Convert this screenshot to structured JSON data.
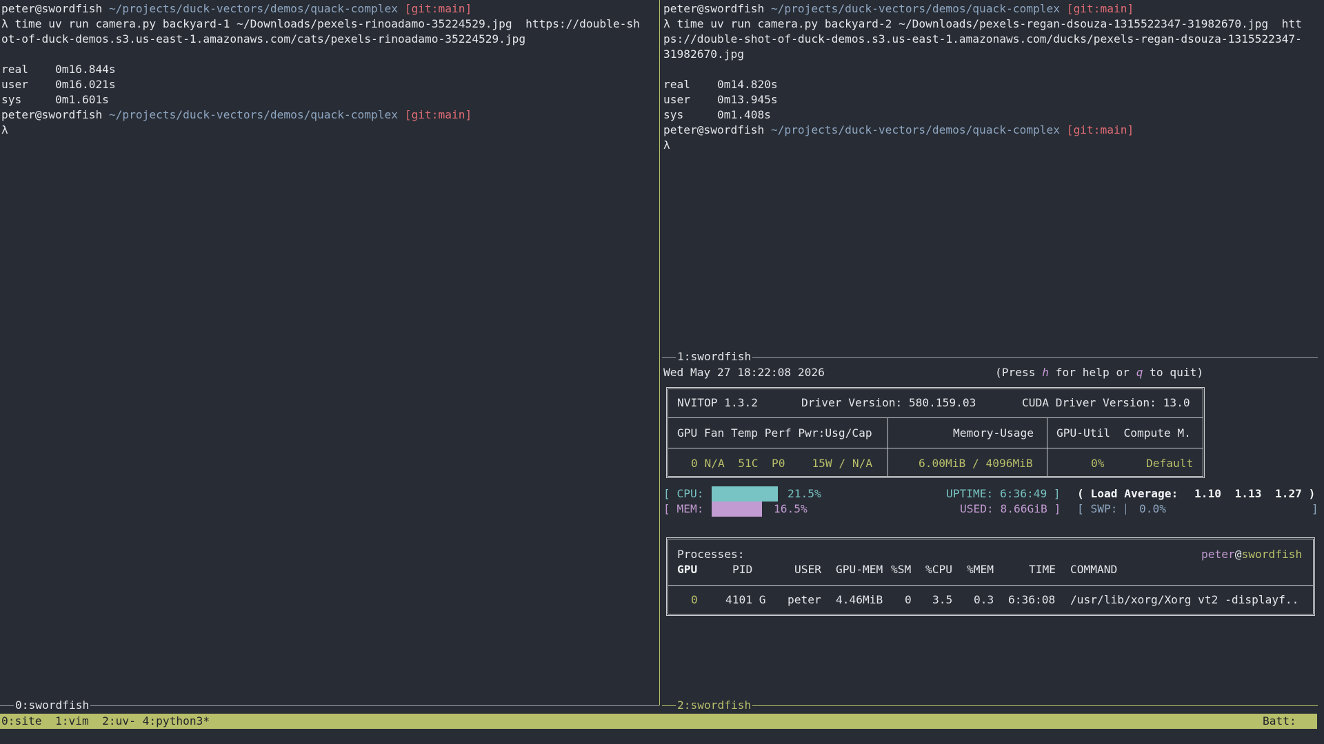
{
  "left_pane": {
    "prompt1_user": "peter@swordfish",
    "prompt1_path": "~/projects/duck-vectors/demos/quack-complex",
    "prompt1_git": "[git:main]",
    "cmd_line1": "λ time uv run camera.py backyard-1 ~/Downloads/pexels-rinoadamo-35224529.jpg  https://double-sh",
    "cmd_line2": "ot-of-duck-demos.s3.us-east-1.amazonaws.com/cats/pexels-rinoadamo-35224529.jpg",
    "real": "real    0m16.844s",
    "user": "user    0m16.021s",
    "sys": "sys     0m1.601s",
    "prompt2_user": "peter@swordfish",
    "prompt2_path": "~/projects/duck-vectors/demos/quack-complex",
    "prompt2_git": "[git:main]",
    "cursor_prompt": "λ",
    "pane_title": "0:swordfish"
  },
  "right_pane": {
    "prompt1_user": "peter@swordfish",
    "prompt1_path": "~/projects/duck-vectors/demos/quack-complex",
    "prompt1_git": "[git:main]",
    "cmd_line1": "λ time uv run camera.py backyard-2 ~/Downloads/pexels-regan-dsouza-1315522347-31982670.jpg  htt",
    "cmd_line2": "ps://double-shot-of-duck-demos.s3.us-east-1.amazonaws.com/ducks/pexels-regan-dsouza-1315522347-",
    "cmd_line3": "31982670.jpg",
    "real": "real    0m14.820s",
    "user": "user    0m13.945s",
    "sys": "sys     0m1.408s",
    "prompt2_user": "peter@swordfish",
    "prompt2_path": "~/projects/duck-vectors/demos/quack-complex",
    "prompt2_git": "[git:main]",
    "cursor_prompt": "λ",
    "pane_title": "2:swordfish"
  },
  "nvitop": {
    "pane_title": "1:swordfish",
    "datetime": "Wed May 27 18:22:08 2026",
    "help_pre": "(Press ",
    "help_h": "h",
    "help_mid": " for help or ",
    "help_q": "q",
    "help_post": " to quit)",
    "version": "NVITOP 1.3.2",
    "driver": "Driver Version: 580.159.03",
    "cuda": "CUDA Driver Version: 13.0",
    "hdr_gpu": "GPU Fan Temp Perf Pwr:Usg/Cap",
    "hdr_mem": "Memory-Usage",
    "hdr_util": "GPU-Util  Compute M.",
    "gpu_row": "0 N/A  51C  P0    15W / N/A",
    "mem_row": "6.00MiB / 4096MiB",
    "util_row": "0%",
    "compute_row": "Default",
    "cpu_label": "[ CPU:",
    "cpu_pct": "21.5%",
    "cpu_fraction": 0.215,
    "mem_label": "[ MEM:",
    "mem_pct": "16.5%",
    "mem_fraction": 0.165,
    "uptime": "UPTIME: 6:36:49 ]",
    "used": "USED: 8.66GiB ]",
    "load_label": "( Load Average:",
    "load_vals": "1.10  1.13  1.27 )",
    "swp_label": "[ SWP:",
    "swp_pct": "0.0%",
    "swp_close": "]",
    "processes_label": "Processes:",
    "host_user": "peter",
    "host_at": "@",
    "host_name": "swordfish",
    "proc_headers": {
      "gpu": "GPU",
      "pid": "PID",
      "user": "USER",
      "gpumem": "GPU-MEM",
      "sm": "%SM",
      "cpu": "%CPU",
      "mem": "%MEM",
      "time": "TIME",
      "command": "COMMAND"
    },
    "proc_row": {
      "gpu": "0",
      "pid": "4101 G",
      "user": "peter",
      "gpumem": "4.46MiB",
      "sm": "0",
      "cpu": "3.5",
      "mem": "0.3",
      "time": "6:36:08",
      "command": "/usr/lib/xorg/Xorg vt2 -displayf.."
    }
  },
  "status_bar": {
    "windows": "0:site  1:vim  2:uv- 4:python3*",
    "batt": "Batt:"
  },
  "colors": {
    "background": "#282c34",
    "accent": "#b8bf6a",
    "cpu_bar": "#78c4c4",
    "mem_bar": "#c19bd2",
    "git": "#e06c75",
    "path": "#8ea6c2"
  }
}
